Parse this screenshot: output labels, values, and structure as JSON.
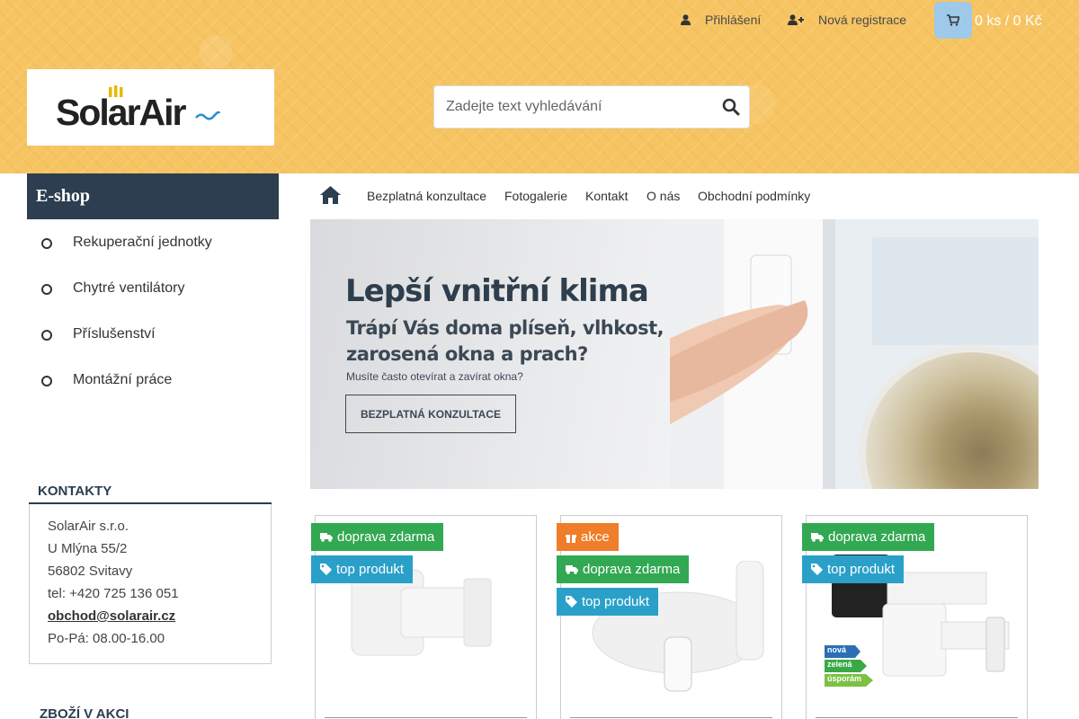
{
  "header": {
    "login_label": "Přihlášení",
    "register_label": "Nová registrace",
    "cart_summary": "0 ks / 0 Kč",
    "logo_text": "SolarAir",
    "search_placeholder": "Zadejte text vyhledávání"
  },
  "sidebar": {
    "title": "E-shop",
    "categories": [
      {
        "label": "Rekuperační jednotky"
      },
      {
        "label": "Chytré ventilátory"
      },
      {
        "label": "Příslušenství"
      },
      {
        "label": "Montážní práce"
      }
    ],
    "contacts": {
      "title": "KONTAKTY",
      "company": "SolarAir s.r.o.",
      "street": "U Mlýna 55/2",
      "city": "56802 Svitavy",
      "phone": "tel: +420 725 136 051",
      "email": "obchod@solarair.cz",
      "hours": "Po-Pá: 08.00-16.00"
    },
    "sale_title": "ZBOŽÍ V AKCI"
  },
  "nav": {
    "links": [
      {
        "label": "Bezplatná konzultace"
      },
      {
        "label": "Fotogalerie"
      },
      {
        "label": "Kontakt"
      },
      {
        "label": "O nás"
      },
      {
        "label": "Obchodní podmínky"
      }
    ]
  },
  "banner": {
    "headline": "Lepší vnitřní klima",
    "sub_line1": "Trápí Vás doma plíseň, vlhkost,",
    "sub_line2": "zarosená okna a prach?",
    "small_text": "Musíte často otevírat a zavírat okna?",
    "button_label": "BEZPLATNÁ KONZULTACE"
  },
  "products": [
    {
      "badges": [
        "doprava zdarma",
        "top produkt"
      ]
    },
    {
      "badges": [
        "akce",
        "doprava zdarma",
        "top produkt"
      ]
    },
    {
      "badges": [
        "doprava zdarma",
        "top produkt"
      ],
      "eco_labels": [
        "nová",
        "zelená",
        "úsporám"
      ]
    }
  ],
  "colors": {
    "header_bg": "#f6c463",
    "sidebar_title_bg": "#2c3e50",
    "badge_shipping": "#32a852",
    "badge_top": "#2aa0c9",
    "badge_sale": "#ef7d29",
    "cart_button": "#9ec9e8"
  }
}
